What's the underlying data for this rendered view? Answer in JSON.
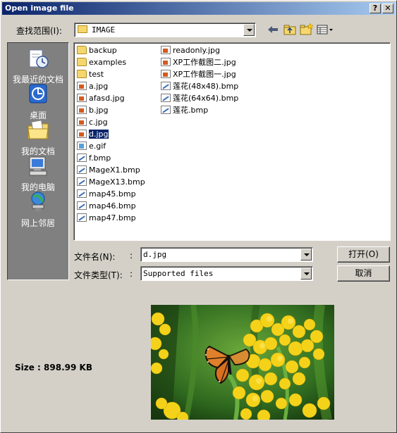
{
  "window": {
    "title": "Open image file",
    "help_button": "?",
    "close_button": "✕"
  },
  "toolbar": {
    "look_in_label": "查找范围(I):",
    "look_in_value": "IMAGE"
  },
  "places": [
    {
      "label": "我最近的文档",
      "icon": "recent-documents-icon"
    },
    {
      "label": "桌面",
      "icon": "desktop-icon"
    },
    {
      "label": "我的文档",
      "icon": "my-documents-icon"
    },
    {
      "label": "我的电脑",
      "icon": "my-computer-icon"
    },
    {
      "label": "网上邻居",
      "icon": "network-places-icon"
    }
  ],
  "files": [
    {
      "name": "backup",
      "type": "folder"
    },
    {
      "name": "examples",
      "type": "folder"
    },
    {
      "name": "test",
      "type": "folder"
    },
    {
      "name": "a.jpg",
      "type": "jpg"
    },
    {
      "name": "afasd.jpg",
      "type": "jpg"
    },
    {
      "name": "b.jpg",
      "type": "jpg"
    },
    {
      "name": "c.jpg",
      "type": "jpg"
    },
    {
      "name": "d.jpg",
      "type": "jpg",
      "selected": true
    },
    {
      "name": "e.gif",
      "type": "gif"
    },
    {
      "name": "f.bmp",
      "type": "bmp"
    },
    {
      "name": "MageX1.bmp",
      "type": "bmp"
    },
    {
      "name": "MageX13.bmp",
      "type": "bmp"
    },
    {
      "name": "map45.bmp",
      "type": "bmp"
    },
    {
      "name": "map46.bmp",
      "type": "bmp"
    },
    {
      "name": "map47.bmp",
      "type": "bmp"
    },
    {
      "name": "readonly.jpg",
      "type": "jpg"
    },
    {
      "name": "XP工作截图二.jpg",
      "type": "jpg"
    },
    {
      "name": "XP工作截图一.jpg",
      "type": "jpg"
    },
    {
      "name": "莲花(48x48).bmp",
      "type": "bmp"
    },
    {
      "name": "莲花(64x64).bmp",
      "type": "bmp"
    },
    {
      "name": "莲花.bmp",
      "type": "bmp"
    }
  ],
  "form": {
    "filename_label": "文件名(N):",
    "filename_value": "d.jpg",
    "filetype_label": "文件类型(T):",
    "filetype_value": "Supported files",
    "open_button": "打开(O)",
    "cancel_button": "取消"
  },
  "preview": {
    "size_text": "Size : 898.99 KB"
  }
}
